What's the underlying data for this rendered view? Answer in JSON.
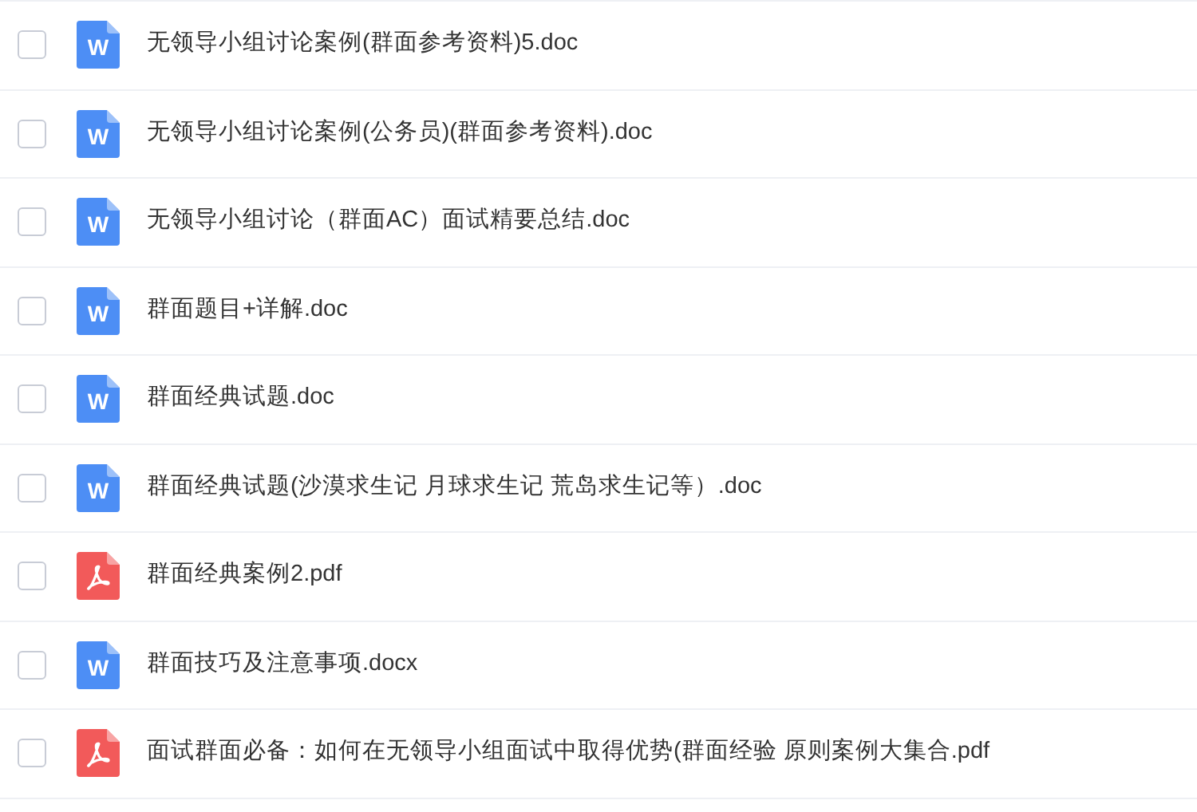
{
  "files": [
    {
      "kind": "doc",
      "icon_letter": "W",
      "name": "无领导小组讨论案例(群面参考资料)5.doc",
      "checked": false
    },
    {
      "kind": "doc",
      "icon_letter": "W",
      "name": "无领导小组讨论案例(公务员)(群面参考资料).doc",
      "checked": false
    },
    {
      "kind": "doc",
      "icon_letter": "W",
      "name": "无领导小组讨论（群面AC）面试精要总结.doc",
      "checked": false
    },
    {
      "kind": "doc",
      "icon_letter": "W",
      "name": "群面题目+详解.doc",
      "checked": false
    },
    {
      "kind": "doc",
      "icon_letter": "W",
      "name": "群面经典试题.doc",
      "checked": false
    },
    {
      "kind": "doc",
      "icon_letter": "W",
      "name": "群面经典试题(沙漠求生记 月球求生记 荒岛求生记等）.doc",
      "checked": false
    },
    {
      "kind": "pdf",
      "name": "群面经典案例2.pdf",
      "checked": false
    },
    {
      "kind": "doc",
      "icon_letter": "W",
      "name": "群面技巧及注意事项.docx",
      "checked": false
    },
    {
      "kind": "pdf",
      "name": "面试群面必备：如何在无领导小组面试中取得优势(群面经验 原则案例大集合.pdf",
      "checked": false
    }
  ]
}
